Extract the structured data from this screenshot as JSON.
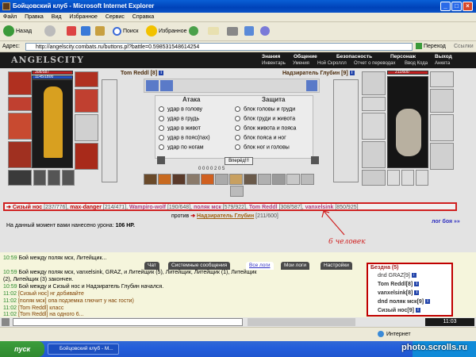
{
  "window": {
    "title": "Бойцовский клуб - Microsoft Internet Explorer"
  },
  "menu": [
    "Файл",
    "Правка",
    "Вид",
    "Избранное",
    "Сервис",
    "Справка"
  ],
  "toolbar": {
    "back": "Назад",
    "search": "Поиск",
    "favorites": "Избранное"
  },
  "address": {
    "label": "Адрес:",
    "url": "http://angelscity.combats.ru/buttons.pl?battle=0.598531548614254",
    "go": "Переход",
    "links": "Ссылки"
  },
  "game": {
    "logo": "ANGELSCITY",
    "menu_top": [
      "Знания",
      "Общение",
      "Безопасность",
      "Персонаж",
      "Выход"
    ],
    "menu_sub": [
      "Инвентарь",
      "Умения",
      "Ной Скроллл",
      "Отчет о переводах",
      "Ввод Кода",
      "Анкета"
    ],
    "player": {
      "name": "Tom Reddl [8]",
      "hp": "308/587",
      "mana": "1145/1800"
    },
    "enemy": {
      "name": "Надзиратель Глубин [9]",
      "hp": "211/600"
    },
    "attack_header": "Атака",
    "defense_header": "Защита",
    "attack_options": [
      "удар в голову",
      "удар в грудь",
      "удар в живот",
      "удар в пояс(пах)",
      "удар по ногам"
    ],
    "defense_options": [
      "блок головы и груди",
      "блок груди и живота",
      "блок живота и пояса",
      "блок пояса и ног",
      "блок ног и головы"
    ],
    "forward_button": "Вперёд!!!",
    "counters": "0  0  0  0  2  0  5",
    "fighters_line": [
      {
        "text": "Сизый нос",
        "extra": "[237/776],",
        "color": "red"
      },
      {
        "text": "max-danger",
        "extra": "[214/471],",
        "color": "red"
      },
      {
        "text": "Wampiro-wolf",
        "extra": "[190/648],",
        "color": "red"
      },
      {
        "text": "поляк мск",
        "extra": "[579/922],",
        "color": "red"
      },
      {
        "text": "Tom Reddl",
        "extra": "[308/587],",
        "color": "red"
      },
      {
        "text": "vanxelsink",
        "extra": "[850/925]",
        "color": "red"
      }
    ],
    "vs_label": "против",
    "vs_enemy": "Надзиратель Глубин",
    "vs_hp": "[211/600]",
    "damage_text": "На данный момент вами нанесено урона:",
    "damage_value": "106 HP.",
    "log_link": "лог боя »»",
    "annotation": "6 человек"
  },
  "chat": {
    "tabs": [
      "Чат",
      "Системные сообщения",
      "Все логи",
      "Мои логи",
      "Настройки"
    ],
    "lines": [
      {
        "time": "10:59",
        "text": "Бой между поляк мск, Литейщик..."
      },
      {
        "time": "10:59",
        "text": "Бой между поляк мск, vanxelsink, GRAZ, и Литейщик (5), Литейщик, Литейщик (1), Литейщик"
      },
      {
        "time": "",
        "text": "(2), Литейщик (3) закончен."
      },
      {
        "time": "10:59",
        "text": "Бой между и Сизый нос и Надзиратель Глубин начался."
      },
      {
        "time": "11:02",
        "text": "[Сизый нос] нг добивайте"
      },
      {
        "time": "11:02",
        "text": "[поляк мск] опа подземка глючит у нас гости)"
      },
      {
        "time": "11:02",
        "text": "[Tom Reddl] класс"
      },
      {
        "time": "11:02",
        "text": "[Tom Reddl] на одного 6..."
      }
    ],
    "side_title": "Бездна (5)",
    "side_items": [
      "dnd GRAZ[9]",
      "Tom Reddl[8]",
      "vanxelsink[8]",
      "dnd поляк мск[9]",
      "Сизый нос[9]"
    ]
  },
  "status": {
    "zone": "Интернет",
    "clock": "11:03"
  },
  "taskbar": {
    "start": "пуск",
    "item": "Бойцовский клуб - M...",
    "watermark": "photo.scrolls.ru"
  }
}
